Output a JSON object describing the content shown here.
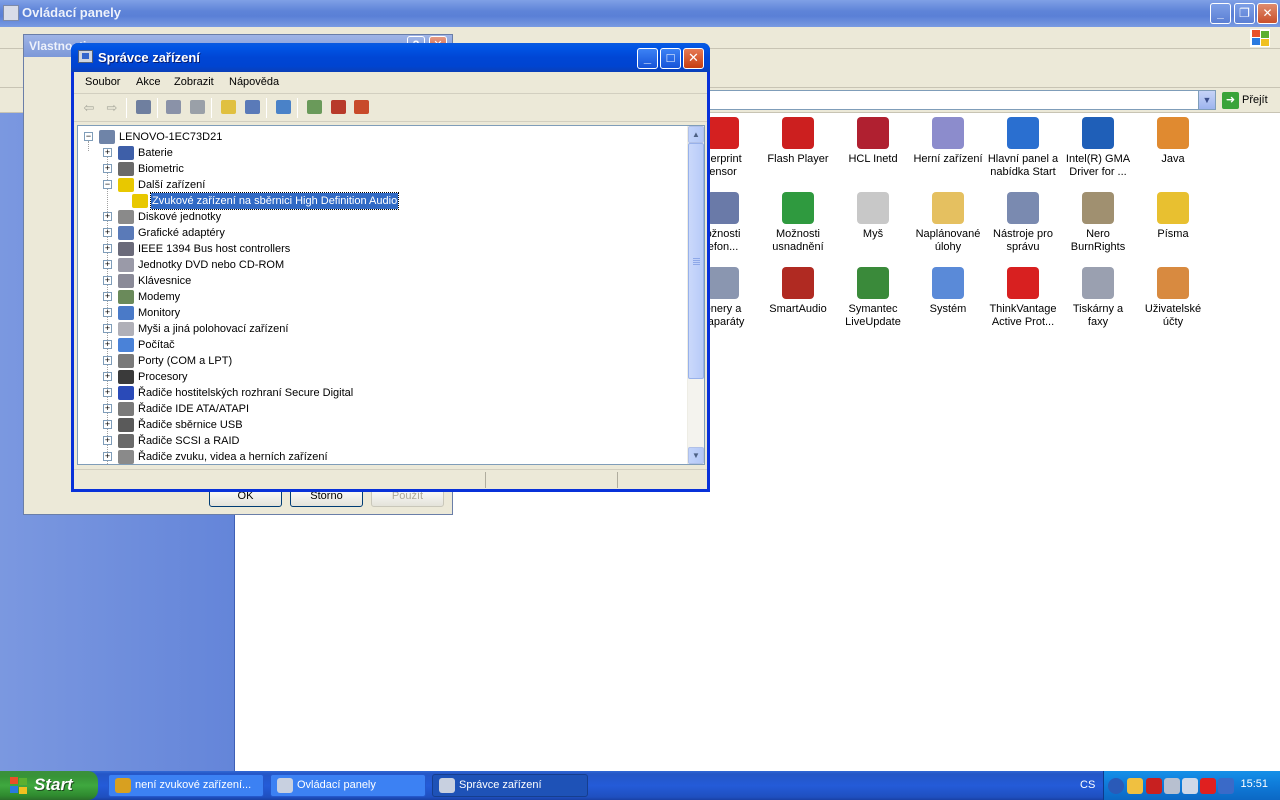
{
  "control_panel": {
    "title": "Ovládací panely",
    "go_label": "Přejít",
    "icons": [
      {
        "label": "Fingerprint Sensor",
        "line1": "gerprint",
        "line2": "ensor",
        "color": "#d42020",
        "icon": "fingerprint-icon"
      },
      {
        "label": "Flash Player",
        "line1": "Flash Player",
        "line2": "",
        "color": "#cc1f1f",
        "icon": "flash-player-icon"
      },
      {
        "label": "HCL Inetd",
        "line1": "HCL Inetd",
        "line2": "",
        "color": "#b02030",
        "icon": "hcl-inetd-icon"
      },
      {
        "label": "Herní zařízení",
        "line1": "Herní zařízení",
        "line2": "",
        "color": "#8c8ccc",
        "icon": "game-controller-icon"
      },
      {
        "label": "Hlavní panel a nabídka Start",
        "line1": "Hlavní panel a",
        "line2": "nabídka Start",
        "color": "#2a6fd0",
        "icon": "taskbar-start-icon"
      },
      {
        "label": "Intel(R) GMA Driver for ...",
        "line1": "Intel(R) GMA",
        "line2": "Driver for ...",
        "color": "#1f5fb8",
        "icon": "intel-gma-icon"
      },
      {
        "label": "Java",
        "line1": "Java",
        "line2": "",
        "color": "#e08a30",
        "icon": "java-icon"
      },
      {
        "label": "Možnosti telefonu",
        "line1": "ožnosti",
        "line2": "efon...",
        "color": "#6a7aa8",
        "icon": "phone-options-icon"
      },
      {
        "label": "Možnosti usnadnění",
        "line1": "Možnosti",
        "line2": "usnadnění",
        "color": "#2f9a3f",
        "icon": "accessibility-icon"
      },
      {
        "label": "Myš",
        "line1": "Myš",
        "line2": "",
        "color": "#c8c8c8",
        "icon": "mouse-icon"
      },
      {
        "label": "Naplánované úlohy",
        "line1": "Naplánované",
        "line2": "úlohy",
        "color": "#e5c060",
        "icon": "scheduled-tasks-icon"
      },
      {
        "label": "Nástroje pro správu",
        "line1": "Nástroje pro",
        "line2": "správu",
        "color": "#7a8ab0",
        "icon": "admin-tools-icon"
      },
      {
        "label": "Nero BurnRights",
        "line1": "Nero",
        "line2": "BurnRights",
        "color": "#a09070",
        "icon": "nero-icon"
      },
      {
        "label": "Písma",
        "line1": "Písma",
        "line2": "",
        "color": "#e8c030",
        "icon": "fonts-folder-icon"
      },
      {
        "label": "Skenery a fotoaparáty",
        "line1": "enery a",
        "line2": "oaparáty",
        "color": "#8a96b0",
        "icon": "scanner-icon"
      },
      {
        "label": "SmartAudio",
        "line1": "SmartAudio",
        "line2": "",
        "color": "#b02a22",
        "icon": "smartaudio-icon"
      },
      {
        "label": "Symantec LiveUpdate",
        "line1": "Symantec",
        "line2": "LiveUpdate",
        "color": "#3a8a3a",
        "icon": "liveupdate-icon"
      },
      {
        "label": "Systém",
        "line1": "Systém",
        "line2": "",
        "color": "#5a8ad8",
        "icon": "system-icon"
      },
      {
        "label": "ThinkVantage Active Prot...",
        "line1": "ThinkVantage",
        "line2": "Active Prot...",
        "color": "#d82020",
        "icon": "thinkvantage-icon"
      },
      {
        "label": "Tiskárny a faxy",
        "line1": "Tiskárny a",
        "line2": "faxy",
        "color": "#9aa0b0",
        "icon": "printer-icon"
      },
      {
        "label": "Uživatelské účty",
        "line1": "Uživatelské",
        "line2": "účty",
        "color": "#d88a40",
        "icon": "user-accounts-icon"
      }
    ]
  },
  "properties_dialog": {
    "title": "Vlastnosti",
    "ok_label": "OK",
    "cancel_label": "Storno",
    "apply_label": "Použít"
  },
  "device_manager": {
    "title": "Správce zařízení",
    "menu": [
      "Soubor",
      "Akce",
      "Zobrazit",
      "Nápověda"
    ],
    "root": "LENOVO-1EC73D21",
    "nodes": [
      {
        "label": "Baterie",
        "expander": "+",
        "icon_color": "#3e5fa8",
        "icon": "battery-icon"
      },
      {
        "label": "Biometric",
        "expander": "+",
        "icon_color": "#6a6a6a",
        "icon": "biometric-icon"
      },
      {
        "label": "Další zařízení",
        "expander": "−",
        "icon_color": "#e8c800",
        "icon": "unknown-device-icon"
      },
      {
        "label": "Zvukové zařízení na sběrnici High Definition Audio",
        "expander": "",
        "icon_color": "#e8c800",
        "icon": "warning-device-icon",
        "child": true,
        "selected": true
      },
      {
        "label": "Diskové jednotky",
        "expander": "+",
        "icon_color": "#8a8a8a",
        "icon": "disk-drive-icon"
      },
      {
        "label": "Grafické adaptéry",
        "expander": "+",
        "icon_color": "#5a7ab8",
        "icon": "display-adapter-icon"
      },
      {
        "label": "IEEE 1394 Bus host controllers",
        "expander": "+",
        "icon_color": "#6a6a7a",
        "icon": "ieee1394-icon"
      },
      {
        "label": "Jednotky DVD nebo CD-ROM",
        "expander": "+",
        "icon_color": "#9a9aa8",
        "icon": "dvd-drive-icon"
      },
      {
        "label": "Klávesnice",
        "expander": "+",
        "icon_color": "#8a8a98",
        "icon": "keyboard-icon"
      },
      {
        "label": "Modemy",
        "expander": "+",
        "icon_color": "#6a8a5a",
        "icon": "modem-icon"
      },
      {
        "label": "Monitory",
        "expander": "+",
        "icon_color": "#4a7ac8",
        "icon": "monitor-icon"
      },
      {
        "label": "Myši a jiná polohovací zařízení",
        "expander": "+",
        "icon_color": "#b0b0b8",
        "icon": "mouse-device-icon"
      },
      {
        "label": "Počítač",
        "expander": "+",
        "icon_color": "#4a82d8",
        "icon": "computer-icon"
      },
      {
        "label": "Porty (COM a LPT)",
        "expander": "+",
        "icon_color": "#7a7a7a",
        "icon": "port-icon"
      },
      {
        "label": "Procesory",
        "expander": "+",
        "icon_color": "#3a3a3a",
        "icon": "processor-icon"
      },
      {
        "label": "Řadiče hostitelských rozhraní Secure Digital",
        "expander": "+",
        "icon_color": "#2a4ab8",
        "icon": "sd-host-icon"
      },
      {
        "label": "Řadiče IDE ATA/ATAPI",
        "expander": "+",
        "icon_color": "#7a7a7a",
        "icon": "ide-controller-icon"
      },
      {
        "label": "Řadiče sběrnice USB",
        "expander": "+",
        "icon_color": "#5a5a5a",
        "icon": "usb-controller-icon"
      },
      {
        "label": "Řadiče SCSI a RAID",
        "expander": "+",
        "icon_color": "#6a6a6a",
        "icon": "scsi-controller-icon"
      },
      {
        "label": "Řadiče zvuku, videa a herních zařízení",
        "expander": "+",
        "icon_color": "#8a8a8a",
        "icon": "sound-video-icon"
      }
    ]
  },
  "taskbar": {
    "start_label": "Start",
    "buttons": [
      {
        "label": "není zvukové zařízení...",
        "icon": "chrome-icon",
        "color": "#d8a020"
      },
      {
        "label": "Ovládací panely",
        "icon": "control-panel-icon",
        "color": "#c8d0e0"
      },
      {
        "label": "Správce zařízení",
        "icon": "device-manager-icon",
        "color": "#c8d0e0",
        "active": true
      }
    ],
    "language": "CS",
    "clock": "15:51"
  }
}
